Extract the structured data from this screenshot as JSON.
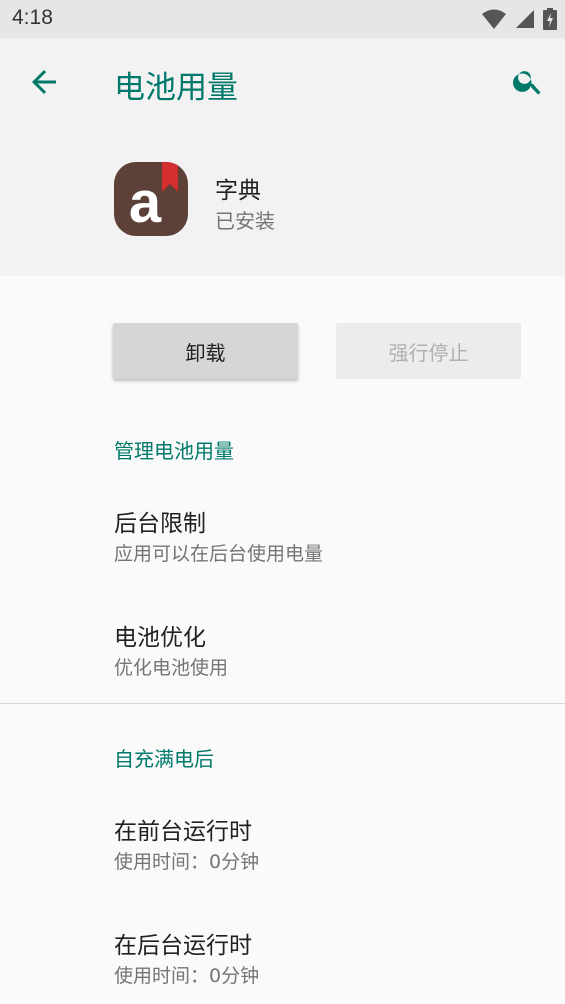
{
  "status_bar": {
    "time": "4:18",
    "icons": [
      "wifi-icon",
      "signal-icon",
      "battery-charging-icon"
    ]
  },
  "toolbar": {
    "title": "电池用量",
    "back_icon": "arrow-back-icon",
    "search_icon": "search-icon"
  },
  "app": {
    "name": "字典",
    "status": "已安装",
    "icon_letter": "a"
  },
  "buttons": {
    "uninstall": "卸载",
    "force_stop": "强行停止"
  },
  "manage_section": {
    "header": "管理电池用量",
    "items": [
      {
        "title": "后台限制",
        "summary": "应用可以在后台使用电量"
      },
      {
        "title": "电池优化",
        "summary": "优化电池使用"
      }
    ]
  },
  "since_charge_section": {
    "header": "自充满电后",
    "items": [
      {
        "title": "在前台运行时",
        "summary": "使用时间：0分钟"
      },
      {
        "title": "在后台运行时",
        "summary": "使用时间：0分钟"
      }
    ]
  },
  "colors": {
    "accent": "#00796b",
    "app_icon_bg": "#5d4037",
    "ribbon": "#d32f2f"
  }
}
